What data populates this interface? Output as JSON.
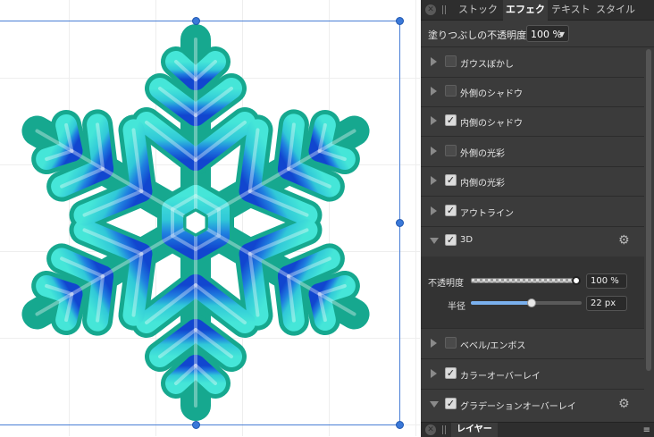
{
  "tabs": [
    {
      "label": "ストック",
      "active": false
    },
    {
      "label": "エフェク",
      "active": true
    },
    {
      "label": "テキスト",
      "active": false
    },
    {
      "label": "スタイル",
      "active": false
    }
  ],
  "fill_opacity": {
    "label": "塗りつぶしの不透明度:",
    "value": "100 %"
  },
  "effects": [
    {
      "label": "ガウスぼかし",
      "checked": false,
      "expanded": false
    },
    {
      "label": "外側のシャドウ",
      "checked": false,
      "expanded": false
    },
    {
      "label": "内側のシャドウ",
      "checked": true,
      "expanded": false
    },
    {
      "label": "外側の光彩",
      "checked": false,
      "expanded": false
    },
    {
      "label": "内側の光彩",
      "checked": true,
      "expanded": false
    },
    {
      "label": "アウトライン",
      "checked": true,
      "expanded": false
    },
    {
      "label": "3D",
      "checked": true,
      "expanded": true,
      "gear": true
    },
    {
      "label": "ベベル/エンボス",
      "checked": false,
      "expanded": false
    },
    {
      "label": "カラーオーバーレイ",
      "checked": true,
      "expanded": false
    },
    {
      "label": "グラデーションオーバーレイ",
      "checked": true,
      "expanded": true,
      "gear": true
    }
  ],
  "detail_3d": {
    "opacity_label": "不透明度",
    "opacity_value": "100 %",
    "opacity_fraction": 1.0,
    "radius_label": "半径",
    "radius_value": "22 px",
    "radius_fraction": 0.55
  },
  "bottom_tab": "レイヤー",
  "colors": {
    "accent": "#3a78d8",
    "snow_top": "#3fe0d6",
    "snow_bottom": "#1050d8",
    "outline": "#16a88f"
  },
  "icons": [
    "close-icon",
    "gear-icon",
    "disclosure-triangle-icon",
    "checkbox-icon",
    "menu-icon"
  ]
}
